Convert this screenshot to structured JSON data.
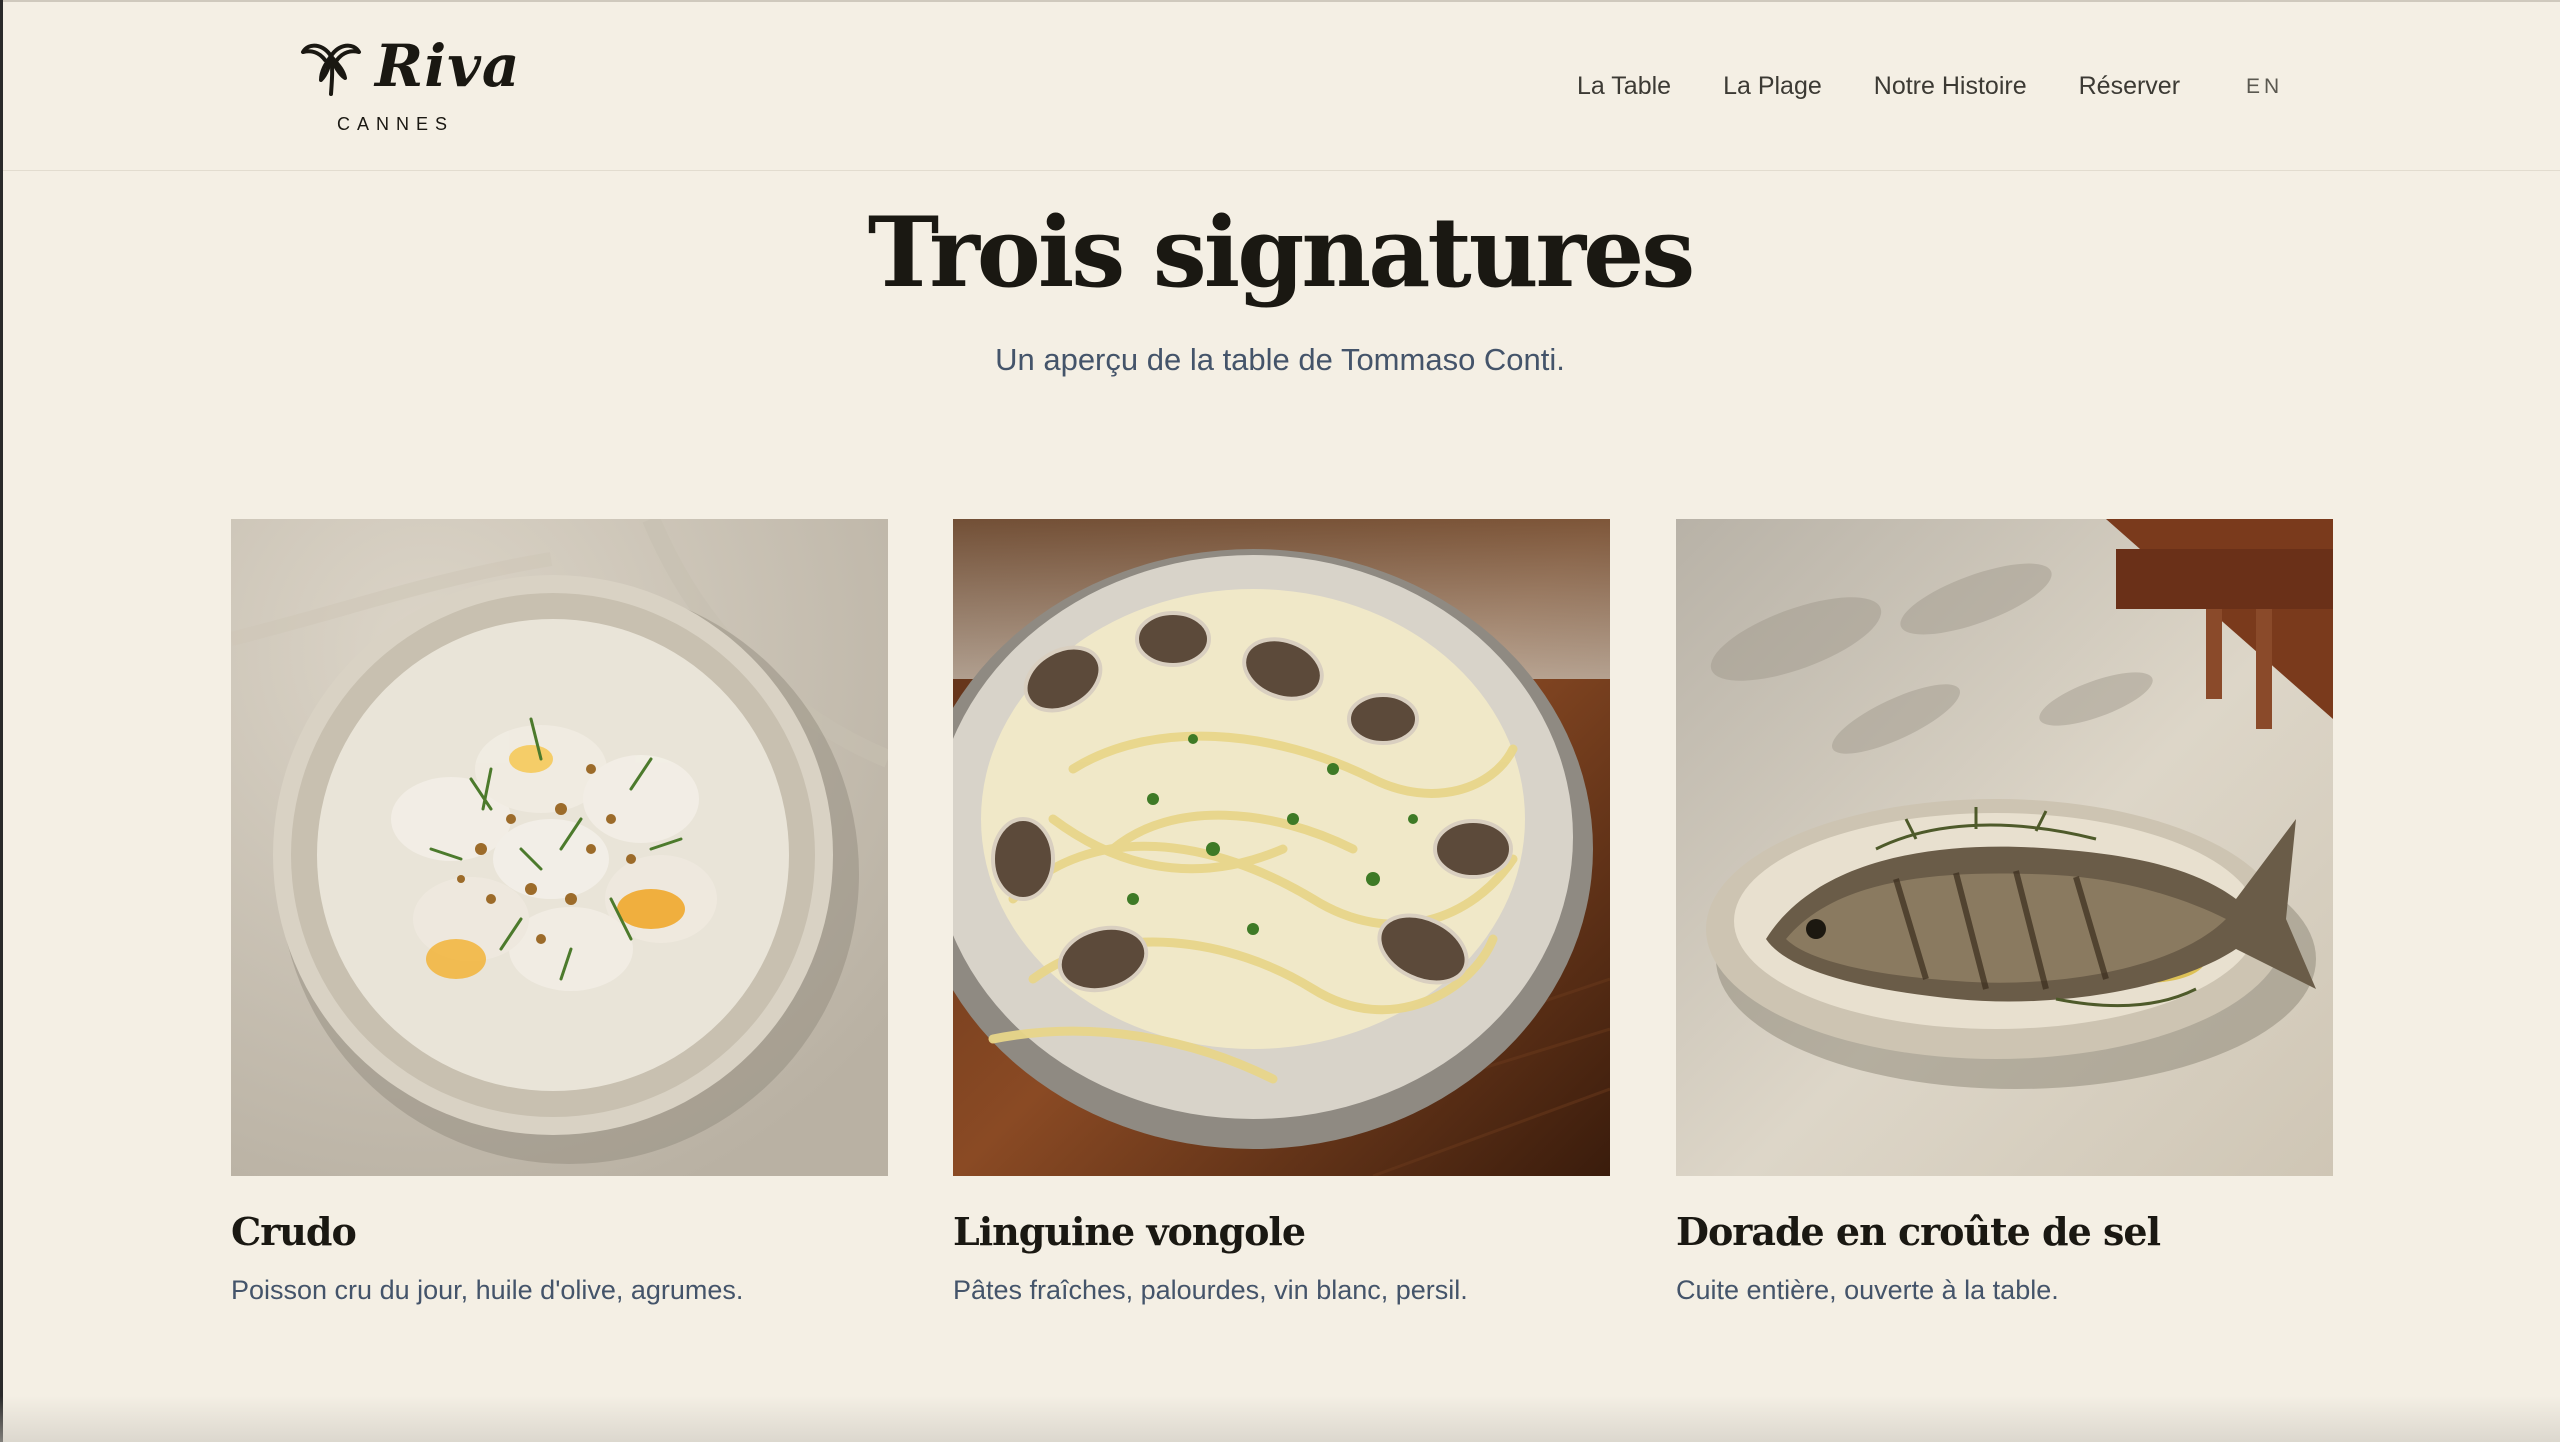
{
  "brand": {
    "name": "Riva",
    "city": "CANNES"
  },
  "nav": {
    "items": [
      {
        "label": "La Table"
      },
      {
        "label": "La Plage"
      },
      {
        "label": "Notre Histoire"
      },
      {
        "label": "Réserver"
      }
    ],
    "language": "EN"
  },
  "hero": {
    "title": "Trois signatures",
    "subtitle": "Un aperçu de la table de Tommaso Conti."
  },
  "dishes": [
    {
      "name": "Crudo",
      "description": "Poisson cru du jour, huile d'olive, agrumes."
    },
    {
      "name": "Linguine vongole",
      "description": "Pâtes fraîches, palourdes, vin blanc, persil."
    },
    {
      "name": "Dorade en croûte de sel",
      "description": "Cuite entière, ouverte à la table."
    }
  ],
  "colors": {
    "background": "#f4efe4",
    "heading": "#1a1812",
    "body_text": "#44546a"
  }
}
